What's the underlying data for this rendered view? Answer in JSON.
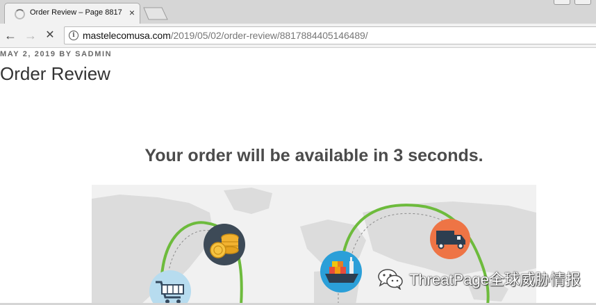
{
  "browser": {
    "tab": {
      "title": "Order Review – Page 8817",
      "close_glyph": "×",
      "status": "loading"
    },
    "nav": {
      "back_glyph": "←",
      "forward_glyph": "→",
      "stop_glyph": "✕"
    },
    "address_bar": {
      "info_glyph": "i",
      "host": "mastelecomusa.com",
      "path": "/2019/05/02/order-review/8817884405146489/"
    }
  },
  "post": {
    "meta": "MAY 2, 2019 BY SADMIN",
    "title": "Order Review"
  },
  "main": {
    "headline": "Your order will be available in 3 seconds.",
    "illustration": {
      "icons": [
        "coins-icon",
        "shopping-cart-icon",
        "cargo-ship-icon",
        "delivery-truck-icon"
      ],
      "colors": {
        "route": "#6dbb3c",
        "coins_bg": "#3d4a57",
        "cart_bg": "#b7dcef",
        "ship_bg": "#2b9fd8",
        "truck_bg": "#ee7445",
        "map_land": "#dcdcdc"
      }
    }
  },
  "watermark": {
    "text": "ThreatPage全球威胁情报"
  }
}
